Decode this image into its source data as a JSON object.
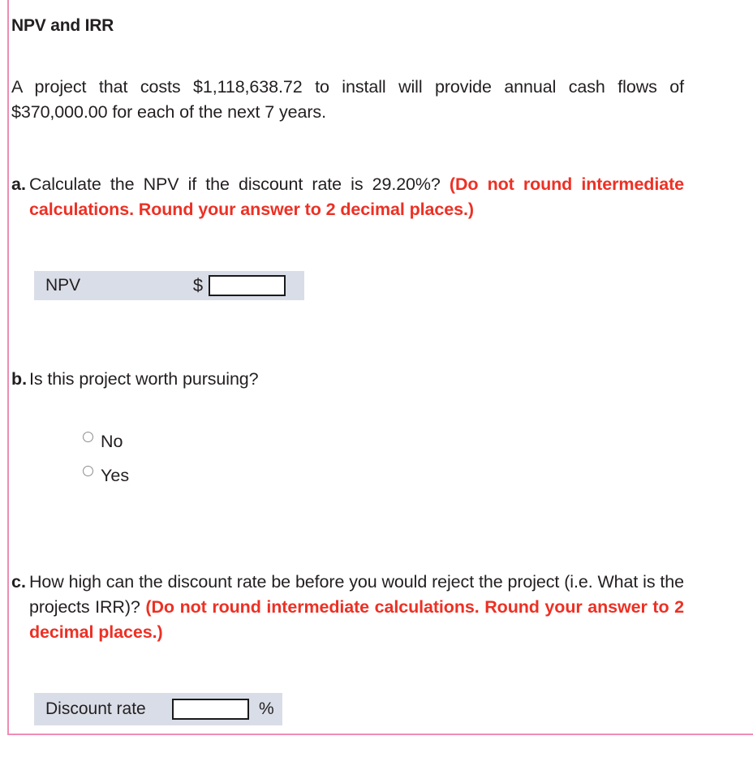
{
  "question": {
    "title": "NPV and IRR",
    "intro": "A project that costs $1,118,638.72 to install will provide annual cash flows of $370,000.00 for each of the next 7 years."
  },
  "parts": {
    "a": {
      "letter": "a.",
      "prompt": "Calculate the NPV if the discount rate is 29.20%? ",
      "instruction": "(Do not round intermediate calculations. Round your answer to 2 decimal places.)",
      "answer_row": {
        "label": "NPV",
        "currency_symbol": "$",
        "input_value": "",
        "input_placeholder": ""
      }
    },
    "b": {
      "letter": "b.",
      "prompt": "Is this project worth pursuing?",
      "options": [
        {
          "label": "No",
          "selected": false
        },
        {
          "label": "Yes",
          "selected": false
        }
      ]
    },
    "c": {
      "letter": "c.",
      "prompt": "How high can the discount rate be before you would reject the project (i.e. What is the projects IRR)? ",
      "instruction": "(Do not round intermediate calculations. Round your answer to 2 decimal places.)",
      "answer_row": {
        "label": "Discount rate",
        "input_value": "",
        "input_placeholder": "",
        "unit_symbol": "%"
      }
    }
  },
  "colors": {
    "frame_border": "#f08cb4",
    "instruction_red": "#ed3024",
    "answer_row_background": "#d9dde7",
    "text": "#231f20",
    "input_border": "#1a1a1a"
  }
}
